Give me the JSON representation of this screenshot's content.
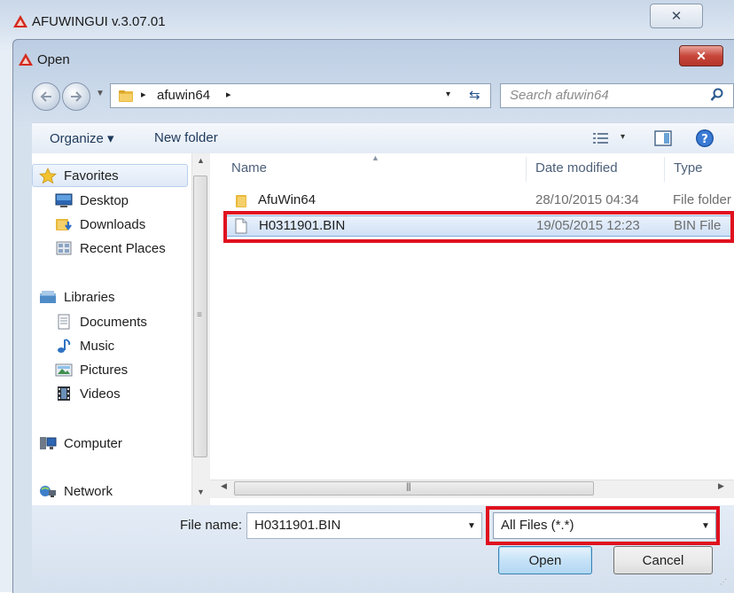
{
  "app_window": {
    "title": "AFUWINGUI v.3.07.01",
    "close_glyph": "✕"
  },
  "dialog": {
    "title": "Open",
    "close_glyph": "✕"
  },
  "address": {
    "crumb": "afuwin64",
    "separator": "▸",
    "dropdown_glyph": "▾"
  },
  "search": {
    "placeholder": "Search afuwin64"
  },
  "toolbar": {
    "organize_label": "Organize ▾",
    "new_folder_label": "New folder",
    "view_dropdown_glyph": "▾"
  },
  "nav_pane": {
    "favorites_label": "Favorites",
    "favorites_items": [
      "Desktop",
      "Downloads",
      "Recent Places"
    ],
    "libraries_label": "Libraries",
    "libraries_items": [
      "Documents",
      "Music",
      "Pictures",
      "Videos"
    ],
    "computer_label": "Computer",
    "network_label": "Network"
  },
  "columns": {
    "name": "Name",
    "date": "Date modified",
    "type": "Type"
  },
  "files": [
    {
      "name": "AfuWin64",
      "date": "28/10/2015 04:34",
      "type": "File folder",
      "kind": "folder-icon"
    },
    {
      "name": "H0311901.BIN",
      "date": "19/05/2015 12:23",
      "type": "BIN File",
      "kind": "file-icon",
      "selected": true
    }
  ],
  "bottom": {
    "file_name_label": "File name:",
    "file_name_value": "H0311901.BIN",
    "file_type_value": "All Files (*.*)",
    "open_label": "Open",
    "cancel_label": "Cancel"
  },
  "colors": {
    "highlight_red": "#e0101e",
    "selection_blue": "#cfe0f6"
  }
}
